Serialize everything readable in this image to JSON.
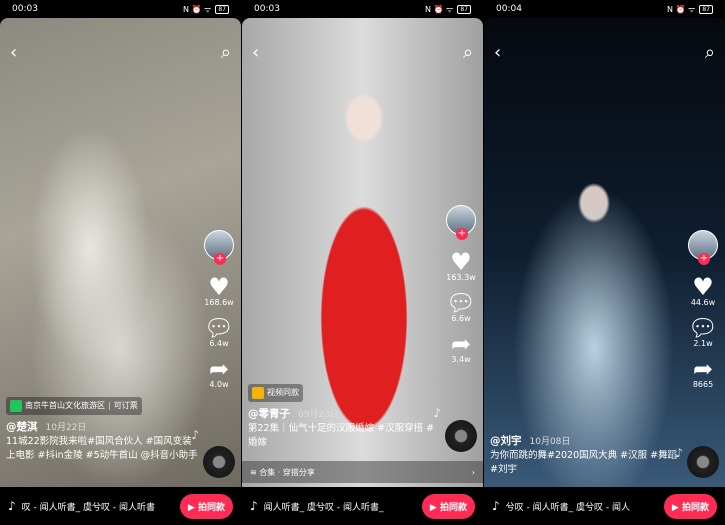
{
  "panels": [
    {
      "time": "00:03",
      "battery": "87",
      "like": "168.6w",
      "comment": "6.4w",
      "share": "4.0w",
      "tag": "南京牛首山文化旅游区",
      "tag_extra": "可订票",
      "tag_color": "#21c45d",
      "user": "@楚淇",
      "date": "10月22日",
      "caption": "11城22影院我来啦#国风合伙人 #国风变装上电影 #抖in金陵 #5动牛首山 @抖音小助手",
      "music": "叹 - 闻人听書_    虞兮叹 - 闻人听書",
      "shoot": "拍同款"
    },
    {
      "time": "00:03",
      "battery": "87",
      "like": "163.3w",
      "comment": "6.6w",
      "share": "3.4w",
      "tag": "视频同款",
      "tag_color": "#f5b400",
      "user": "@零青子",
      "date": "09月23日",
      "caption": "第22集｜仙气十足的汉服婚嫁 #汉服穿搭 #婚嫁",
      "collection": "合集 · 穿搭分享",
      "music": "闻人听書_    虞兮叹 - 闻人听書_",
      "shoot": "拍同款"
    },
    {
      "time": "00:04",
      "battery": "87",
      "like": "44.6w",
      "comment": "2.1w",
      "share": "8665",
      "user": "@刘宇",
      "date": "10月08日",
      "caption": "为你而跳的舞#2020国风大典 #汉服 #舞蹈 #刘宇",
      "music": "兮叹 - 闻人听書_    虞兮叹 - 闻人",
      "shoot": "拍同款"
    }
  ],
  "colors": {
    "accent": "#fe2c55"
  }
}
